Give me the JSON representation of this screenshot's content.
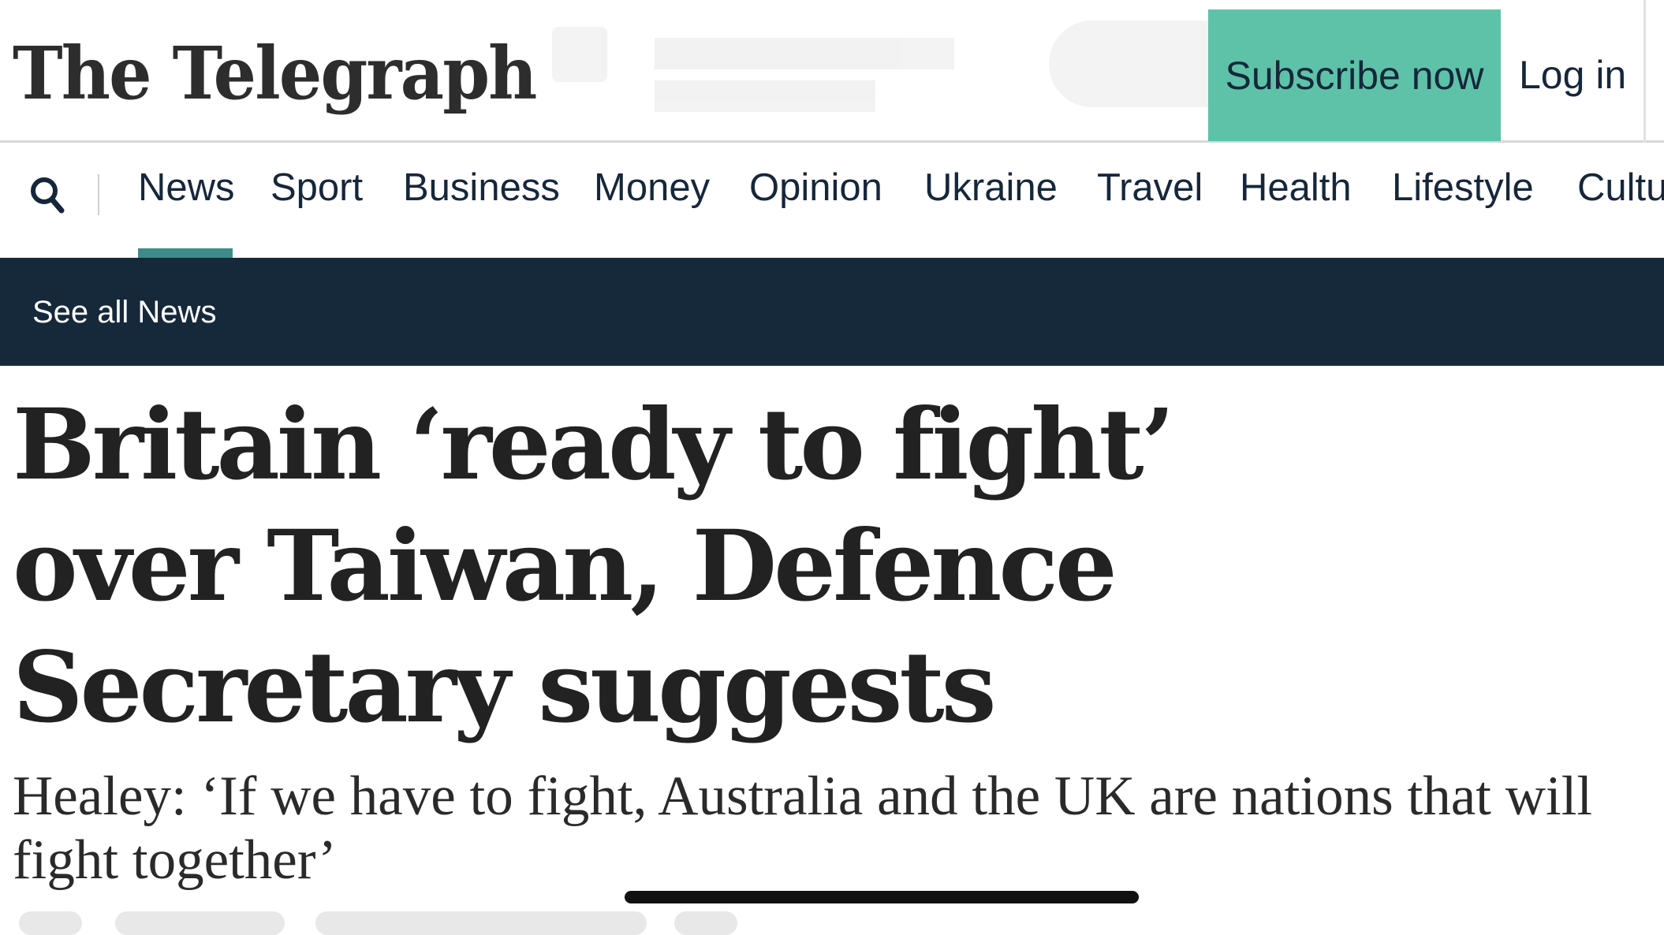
{
  "header": {
    "logo_text": "The Telegraph",
    "subscribe_label": "Subscribe now",
    "login_label": "Log in"
  },
  "nav": {
    "search_icon": "search-icon",
    "items": [
      {
        "label": "News",
        "active": true
      },
      {
        "label": "Sport"
      },
      {
        "label": "Business"
      },
      {
        "label": "Money"
      },
      {
        "label": "Opinion"
      },
      {
        "label": "Ukraine"
      },
      {
        "label": "Travel"
      },
      {
        "label": "Health"
      },
      {
        "label": "Lifestyle"
      },
      {
        "label": "Culture"
      }
    ]
  },
  "subnav": {
    "see_all_label": "See all News"
  },
  "article": {
    "headline": "Britain ‘ready to fight’ over Taiwan, Defence Secretary suggests",
    "standfirst": "Healey: ‘If we have to fight, Australia and the UK are nations that will fight together’"
  },
  "colors": {
    "accent": "#5ec2a9",
    "nav_active": "#3e8c87",
    "subnav_bg": "#16293a",
    "text": "#222222"
  }
}
